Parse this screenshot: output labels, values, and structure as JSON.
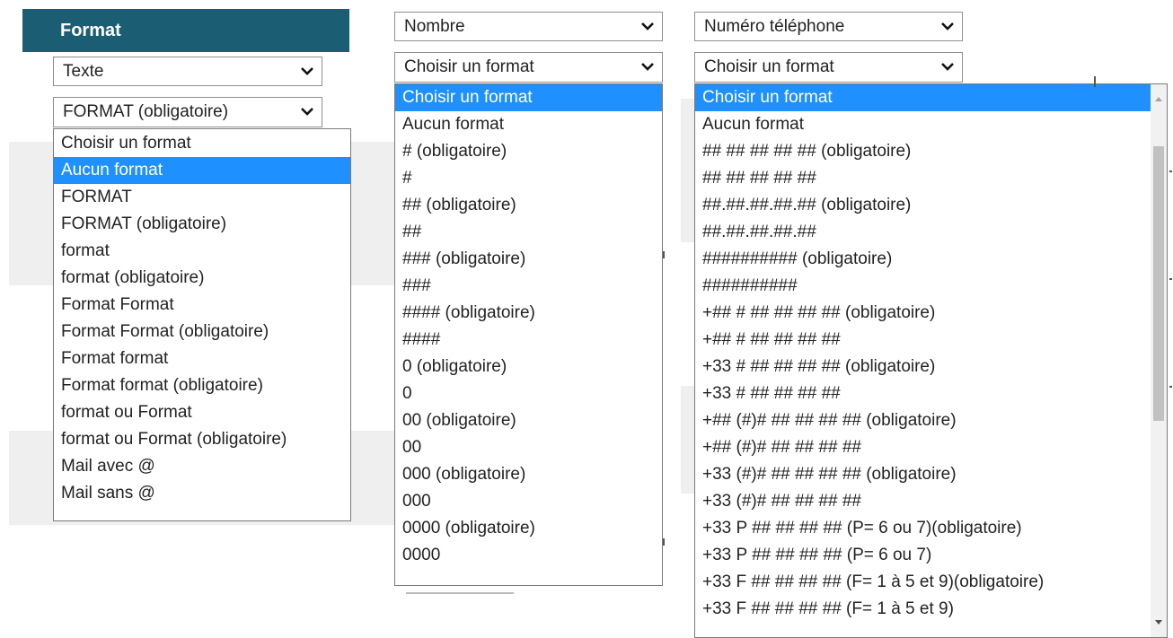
{
  "header": {
    "title": "Format"
  },
  "column1": {
    "type_select": {
      "value": "Texte"
    },
    "format_select": {
      "value": "FORMAT (obligatoire)"
    },
    "options": [
      "Choisir un format",
      "Aucun format",
      "FORMAT",
      "FORMAT (obligatoire)",
      "format",
      "format (obligatoire)",
      "Format Format",
      "Format Format (obligatoire)",
      "Format format",
      "Format format (obligatoire)",
      "format ou Format",
      "format ou Format (obligatoire)",
      "Mail avec @",
      "Mail sans @"
    ],
    "selected_option": "Aucun format"
  },
  "column2": {
    "type_select": {
      "value": "Nombre"
    },
    "format_select": {
      "value": "Choisir un format"
    },
    "options": [
      "Choisir un format",
      "Aucun format",
      "# (obligatoire)",
      "#",
      "## (obligatoire)",
      "##",
      "### (obligatoire)",
      "###",
      "#### (obligatoire)",
      "####",
      "0 (obligatoire)",
      "0",
      "00 (obligatoire)",
      "00",
      "000 (obligatoire)",
      "000",
      "0000 (obligatoire)",
      "0000"
    ],
    "selected_option": "Choisir un format"
  },
  "column3": {
    "type_select": {
      "value": "Numéro téléphone"
    },
    "format_select": {
      "value": "Choisir un format"
    },
    "options": [
      "Choisir un format",
      "Aucun format",
      "## ## ## ## ## (obligatoire)",
      "## ## ## ## ##",
      "##.##.##.##.## (obligatoire)",
      "##.##.##.##.##",
      "########## (obligatoire)",
      "##########",
      "+## # ## ## ## ## (obligatoire)",
      "+## # ## ## ## ##",
      "+33 # ## ## ## ## (obligatoire)",
      "+33 # ## ## ## ##",
      "+## (#)# ## ## ## ## (obligatoire)",
      "+## (#)# ## ## ## ##",
      "+33 (#)# ## ## ## ## (obligatoire)",
      "+33 (#)# ## ## ## ##",
      "+33 P ## ## ## ## (P= 6 ou 7)(obligatoire)",
      "+33 P ## ## ## ## (P= 6 ou 7)",
      "+33 F ## ## ## ## (F= 1 à 5 et 9)(obligatoire)",
      "+33 F ## ## ## ## (F= 1 à 5 et 9)"
    ],
    "selected_option": "Choisir un format",
    "scroll": {
      "thumb_start_fraction": 0.06,
      "thumb_size_fraction": 0.56
    }
  },
  "icons": {
    "dropdown": "chevron-down-icon",
    "scroll_up": "arrow-up-icon",
    "scroll_down": "arrow-down-icon"
  },
  "colors": {
    "header_bg": "#1b5e73",
    "selected_bg": "#1e90ff",
    "selected_text": "#ffffff"
  }
}
